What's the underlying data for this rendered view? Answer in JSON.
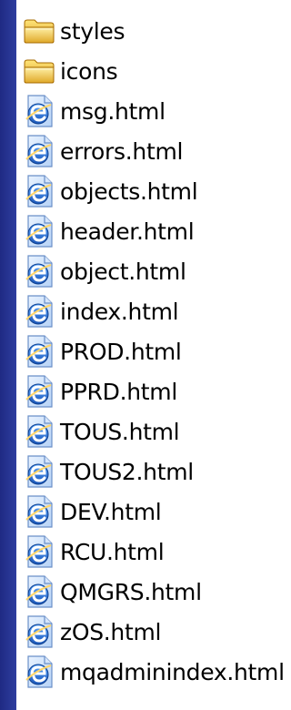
{
  "colors": {
    "background": "#2f3fa0",
    "folder_accent": "#f2c94c",
    "html_icon_blue": "#2f78d6",
    "html_icon_border": "#7aa6e8"
  },
  "items": [
    {
      "label": "styles",
      "icon": "folder-icon"
    },
    {
      "label": "icons",
      "icon": "folder-icon"
    },
    {
      "label": "msg.html",
      "icon": "html-file-icon"
    },
    {
      "label": "errors.html",
      "icon": "html-file-icon"
    },
    {
      "label": "objects.html",
      "icon": "html-file-icon"
    },
    {
      "label": "header.html",
      "icon": "html-file-icon"
    },
    {
      "label": "object.html",
      "icon": "html-file-icon"
    },
    {
      "label": "index.html",
      "icon": "html-file-icon"
    },
    {
      "label": "PROD.html",
      "icon": "html-file-icon"
    },
    {
      "label": "PPRD.html",
      "icon": "html-file-icon"
    },
    {
      "label": "TOUS.html",
      "icon": "html-file-icon"
    },
    {
      "label": "TOUS2.html",
      "icon": "html-file-icon"
    },
    {
      "label": "DEV.html",
      "icon": "html-file-icon"
    },
    {
      "label": "RCU.html",
      "icon": "html-file-icon"
    },
    {
      "label": "QMGRS.html",
      "icon": "html-file-icon"
    },
    {
      "label": "zOS.html",
      "icon": "html-file-icon"
    },
    {
      "label": "mqadminindex.html",
      "icon": "html-file-icon"
    }
  ]
}
